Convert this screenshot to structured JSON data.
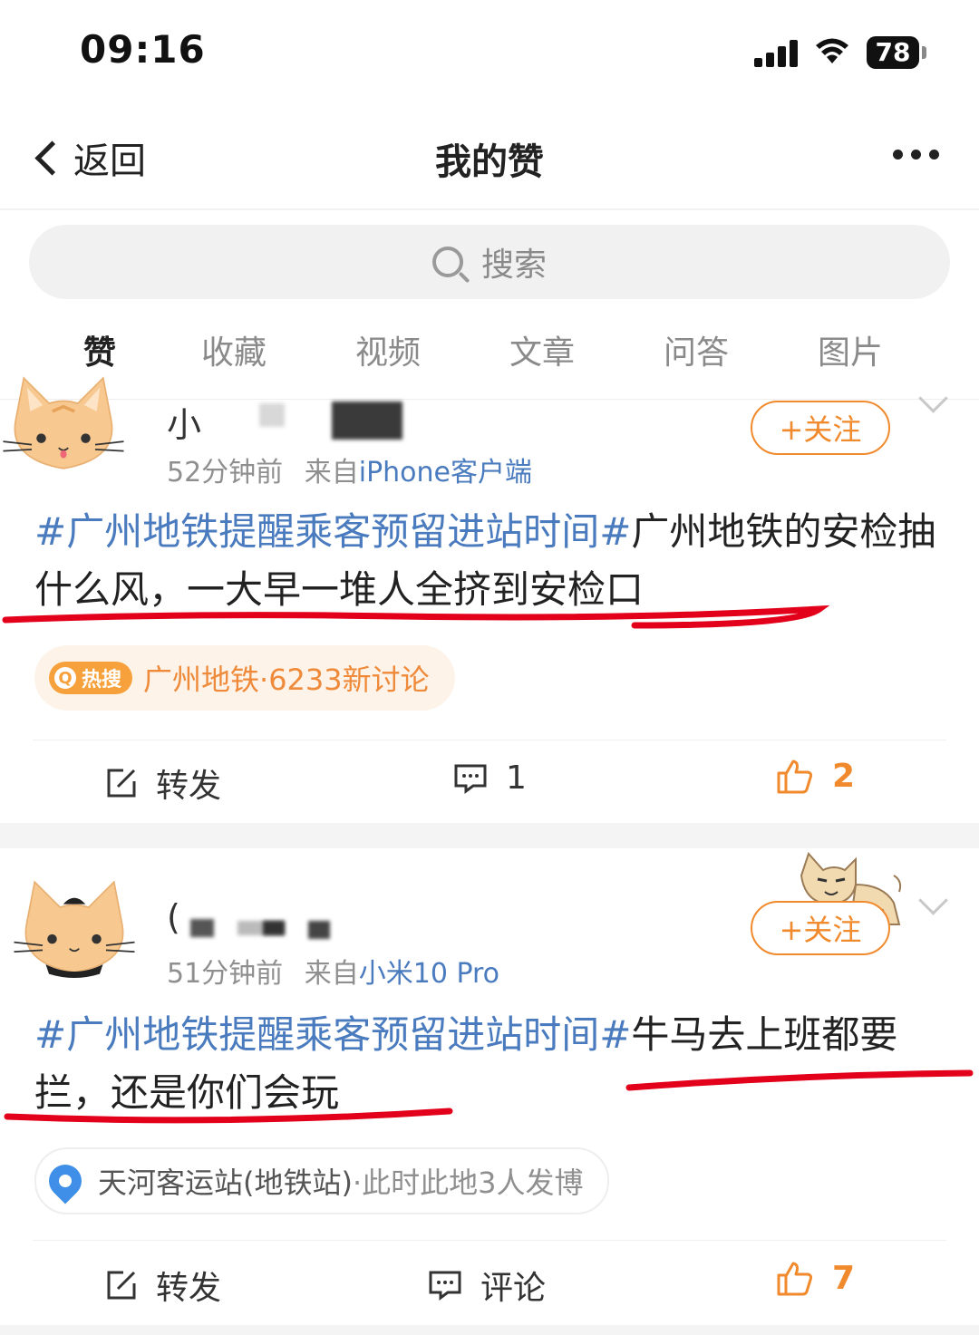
{
  "status_bar": {
    "time": "09:16",
    "battery": "78"
  },
  "nav": {
    "back_label": "返回",
    "title": "我的赞"
  },
  "search": {
    "placeholder": "搜索"
  },
  "tabs": [
    {
      "label": "赞"
    },
    {
      "label": "收藏"
    },
    {
      "label": "视频"
    },
    {
      "label": "文章"
    },
    {
      "label": "问答"
    },
    {
      "label": "图片"
    }
  ],
  "posts": [
    {
      "username": "小",
      "time": "52分钟前",
      "source_prefix": "来自",
      "source": "iPhone客户端",
      "follow_label": "+关注",
      "hashtag": "#广州地铁提醒乘客预留进站时间#",
      "text": "广州地铁的安检抽什么风，一大早一堆人全挤到安检口",
      "hot_badge": "热搜",
      "hot_text": "广州地铁·6233新讨论",
      "repost_label": "转发",
      "comment_label": "1",
      "like_count": "2"
    },
    {
      "username": "(",
      "time": "51分钟前",
      "source_prefix": "来自",
      "source": "小米10 Pro",
      "follow_label": "+关注",
      "hashtag": "#广州地铁提醒乘客预留进站时间#",
      "text": "牛马去上班都要拦，还是你们会玩",
      "location": "天河客运站(地铁站)",
      "location_sub": "·此时此地3人发博",
      "repost_label": "转发",
      "comment_label": "评论",
      "like_count": "7"
    }
  ]
}
